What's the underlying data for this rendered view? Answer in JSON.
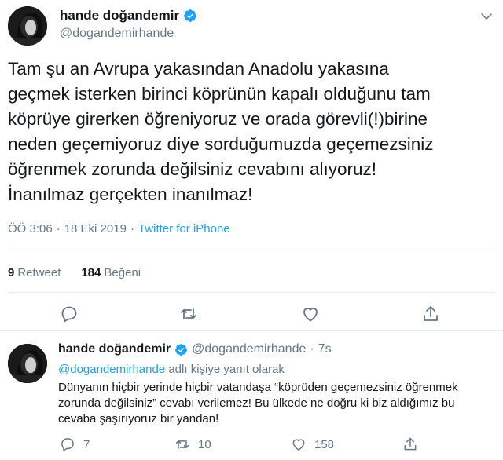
{
  "main_tweet": {
    "display_name": "hande doğandemir",
    "handle": "@dogandemirhande",
    "text": "Tam şu an Avrupa yakasından Anadolu yakasına\ngeçmek isterken birinci köprünün kapalı olduğunu tam\nköprüye  girerken öğreniyoruz ve orada görevli(!)birine\nneden geçemiyoruz diye sorduğumuzda geçemezsiniz\nöğrenmek zorunda değilsiniz cevabını alıyoruz!\nİnanılmaz gerçekten inanılmaz!",
    "time": "ÖÖ 3:06",
    "separator": "·",
    "date": "18 Eki 2019",
    "source": "Twitter for iPhone",
    "retweet_count": "9",
    "retweet_label": "Retweet",
    "like_count": "184",
    "like_label": "Beğeni"
  },
  "reply_tweet": {
    "display_name": "hande doğandemir",
    "handle": "@dogandemirhande",
    "separator": "·",
    "time_ago": "7s",
    "reply_to_mention": "@dogandemirhande",
    "reply_to_suffix": "adlı kişiye yanıt olarak",
    "text": "Dünyanın hiçbir yerinde hiçbir vatandaşa “köprüden geçemezsiniz öğrenmek zorunda değilsiniz” cevabı verilemez! Bu ülkede ne doğru ki biz aldığımız bu cevaba şaşırıyoruz bir yandan!",
    "reply_count": "7",
    "retweet_count": "10",
    "like_count": "158"
  },
  "icons": {
    "verified": "verified-badge-icon",
    "more": "chevron-down-icon",
    "reply": "reply-icon",
    "retweet": "retweet-icon",
    "like": "heart-icon",
    "share": "share-icon"
  },
  "colors": {
    "link": "#1da1f2",
    "secondary_text": "#657786",
    "primary_text": "#14171a",
    "divider": "#e6ecf0"
  }
}
